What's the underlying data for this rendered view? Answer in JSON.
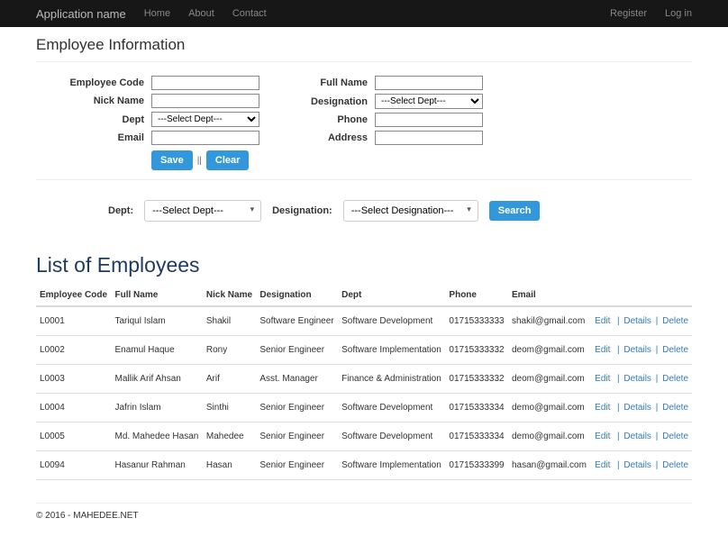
{
  "navbar": {
    "brand": "Application name",
    "links": [
      "Home",
      "About",
      "Contact"
    ],
    "right": [
      "Register",
      "Log in"
    ]
  },
  "form": {
    "title": "Employee Information",
    "labels": {
      "code": "Employee Code",
      "nick": "Nick Name",
      "dept": "Dept",
      "email": "Email",
      "full": "Full Name",
      "desig": "Designation",
      "phone": "Phone",
      "address": "Address"
    },
    "dept_placeholder": "---Select Dept---",
    "save": "Save",
    "sep": "||",
    "clear": "Clear"
  },
  "search": {
    "dept_label": "Dept:",
    "dept_placeholder": "---Select Dept---",
    "desig_label": "Designation:",
    "desig_placeholder": "---Select Designation---",
    "search_btn": "Search"
  },
  "list": {
    "title": "List of Employees",
    "headers": [
      "Employee Code",
      "Full Name",
      "Nick Name",
      "Designation",
      "Dept",
      "Phone",
      "Email"
    ],
    "action_edit": "Edit",
    "action_details": "Details",
    "action_delete": "Delete",
    "rows": [
      {
        "code": "L0001",
        "full": "Tariqul Islam",
        "nick": "Shakil",
        "desig": "Software Engineer",
        "dept": "Software Development",
        "phone": "01715333333",
        "email": "shakil@gmail.com"
      },
      {
        "code": "L0002",
        "full": "Enamul Haque",
        "nick": "Rony",
        "desig": "Senior Engineer",
        "dept": "Software Implementation",
        "phone": "01715333332",
        "email": "deom@gmail.com"
      },
      {
        "code": "L0003",
        "full": "Mallik Arif Ahsan",
        "nick": "Arif",
        "desig": "Asst. Manager",
        "dept": "Finance & Administration",
        "phone": "01715333332",
        "email": "deom@gmail.com"
      },
      {
        "code": "L0004",
        "full": "Jafrin Islam",
        "nick": "Sinthi",
        "desig": "Senior Engineer",
        "dept": "Software Development",
        "phone": "01715333334",
        "email": "demo@gmail.com"
      },
      {
        "code": "L0005",
        "full": "Md. Mahedee Hasan",
        "nick": "Mahedee",
        "desig": "Senior Engineer",
        "dept": "Software Development",
        "phone": "01715333334",
        "email": "demo@gmail.com"
      },
      {
        "code": "L0094",
        "full": "Hasanur Rahman",
        "nick": "Hasan",
        "desig": "Senior Engineer",
        "dept": "Software Implementation",
        "phone": "01715333399",
        "email": "hasan@gmail.com"
      }
    ]
  },
  "footer": "© 2016 - MAHEDEE.NET"
}
